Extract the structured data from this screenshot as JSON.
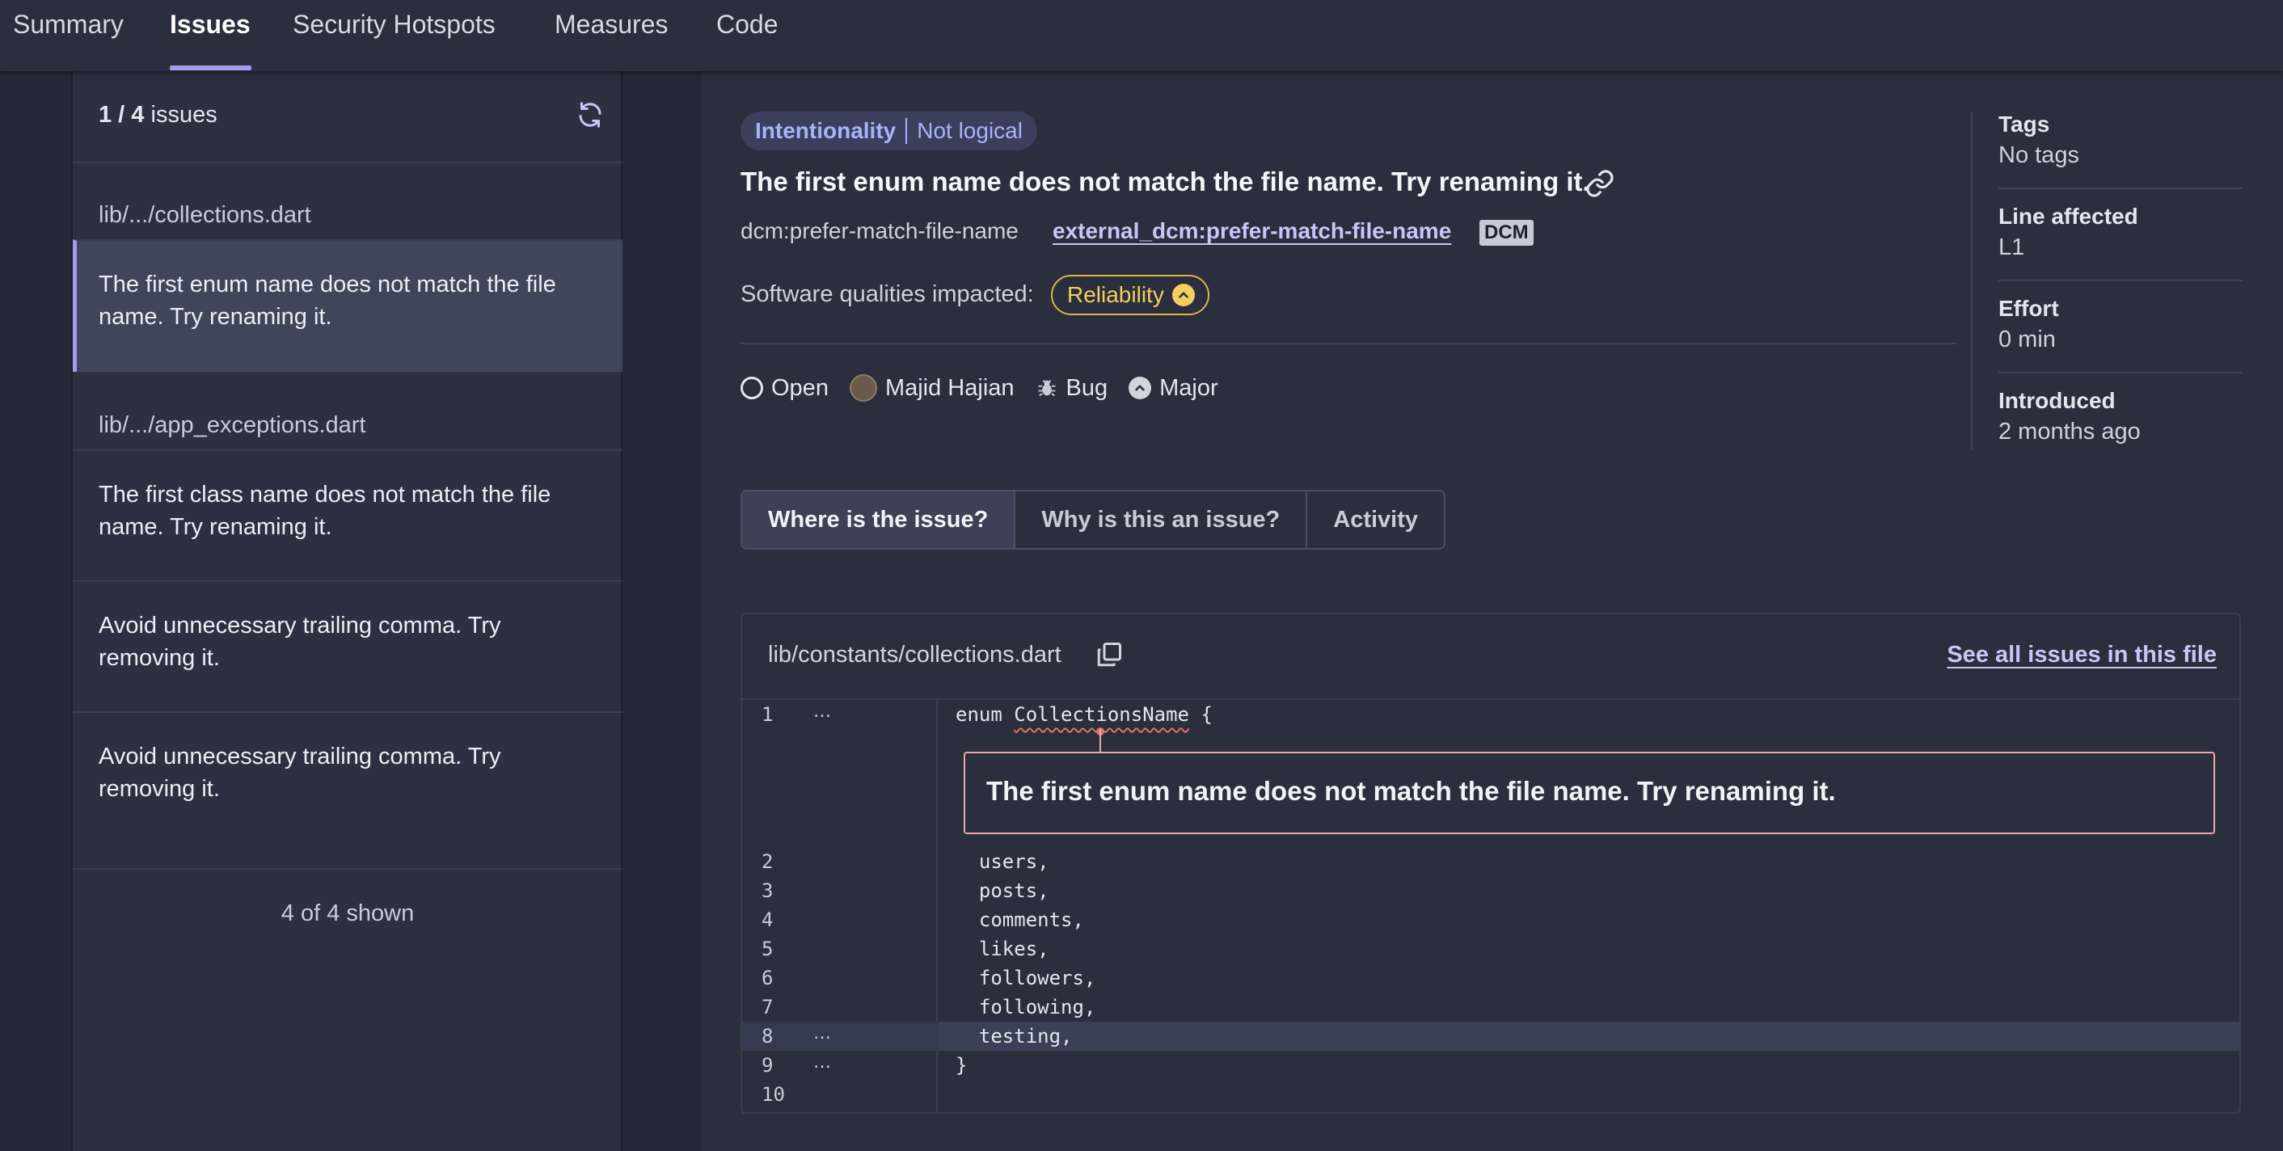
{
  "nav": {
    "tabs": [
      {
        "label": "Summary"
      },
      {
        "label": "Issues"
      },
      {
        "label": "Security Hotspots"
      },
      {
        "label": "Measures"
      },
      {
        "label": "Code"
      }
    ],
    "active": "Issues"
  },
  "list": {
    "count_current": "1 / 4",
    "count_suffix": " issues",
    "groups": [
      {
        "file": "lib/.../collections.dart"
      },
      {
        "file": "lib/.../app_exceptions.dart"
      }
    ],
    "items": [
      {
        "text": "The first enum name does not match the file name. Try renaming it."
      },
      {
        "text": "The first class name does not match the file name. Try renaming it."
      },
      {
        "text": "Avoid unnecessary trailing comma. Try removing it."
      },
      {
        "text": "Avoid unnecessary trailing comma. Try removing it."
      }
    ],
    "shown": "4 of 4 shown"
  },
  "issue": {
    "attribute": "Intentionality",
    "attribute_sub": "Not logical",
    "title": "The first enum name does not match the file name. Try renaming it.",
    "rule_key": "dcm:prefer-match-file-name",
    "rule_link": "external_dcm:prefer-match-file-name",
    "rule_badge": "DCM",
    "qualities_label": "Software qualities impacted:",
    "quality": "Reliability",
    "status": "Open",
    "assignee": "Majid Hajian",
    "type": "Bug",
    "severity": "Major"
  },
  "meta": {
    "tags_label": "Tags",
    "tags_value": "No tags",
    "line_label": "Line affected",
    "line_value": "L1",
    "effort_label": "Effort",
    "effort_value": "0 min",
    "introduced_label": "Introduced",
    "introduced_value": "2 months ago"
  },
  "detail_tabs": [
    {
      "label": "Where is the issue?"
    },
    {
      "label": "Why is this an issue?"
    },
    {
      "label": "Activity"
    }
  ],
  "code": {
    "file_path": "lib/constants/collections.dart",
    "see_all": "See all issues in this file",
    "inline_message": "The first enum name does not match the file name. Try renaming it.",
    "line1_prefix": "enum ",
    "line1_name": "CollectionsName",
    "line1_suffix": " {",
    "lines": [
      {
        "num": "2",
        "text": "  users,"
      },
      {
        "num": "3",
        "text": "  posts,"
      },
      {
        "num": "4",
        "text": "  comments,"
      },
      {
        "num": "5",
        "text": "  likes,"
      },
      {
        "num": "6",
        "text": "  followers,"
      },
      {
        "num": "7",
        "text": "  following,"
      },
      {
        "num": "8",
        "text": "  testing,"
      },
      {
        "num": "9",
        "text": "}"
      },
      {
        "num": "10",
        "text": ""
      }
    ],
    "line1_num": "1",
    "ellipsis": "…"
  }
}
